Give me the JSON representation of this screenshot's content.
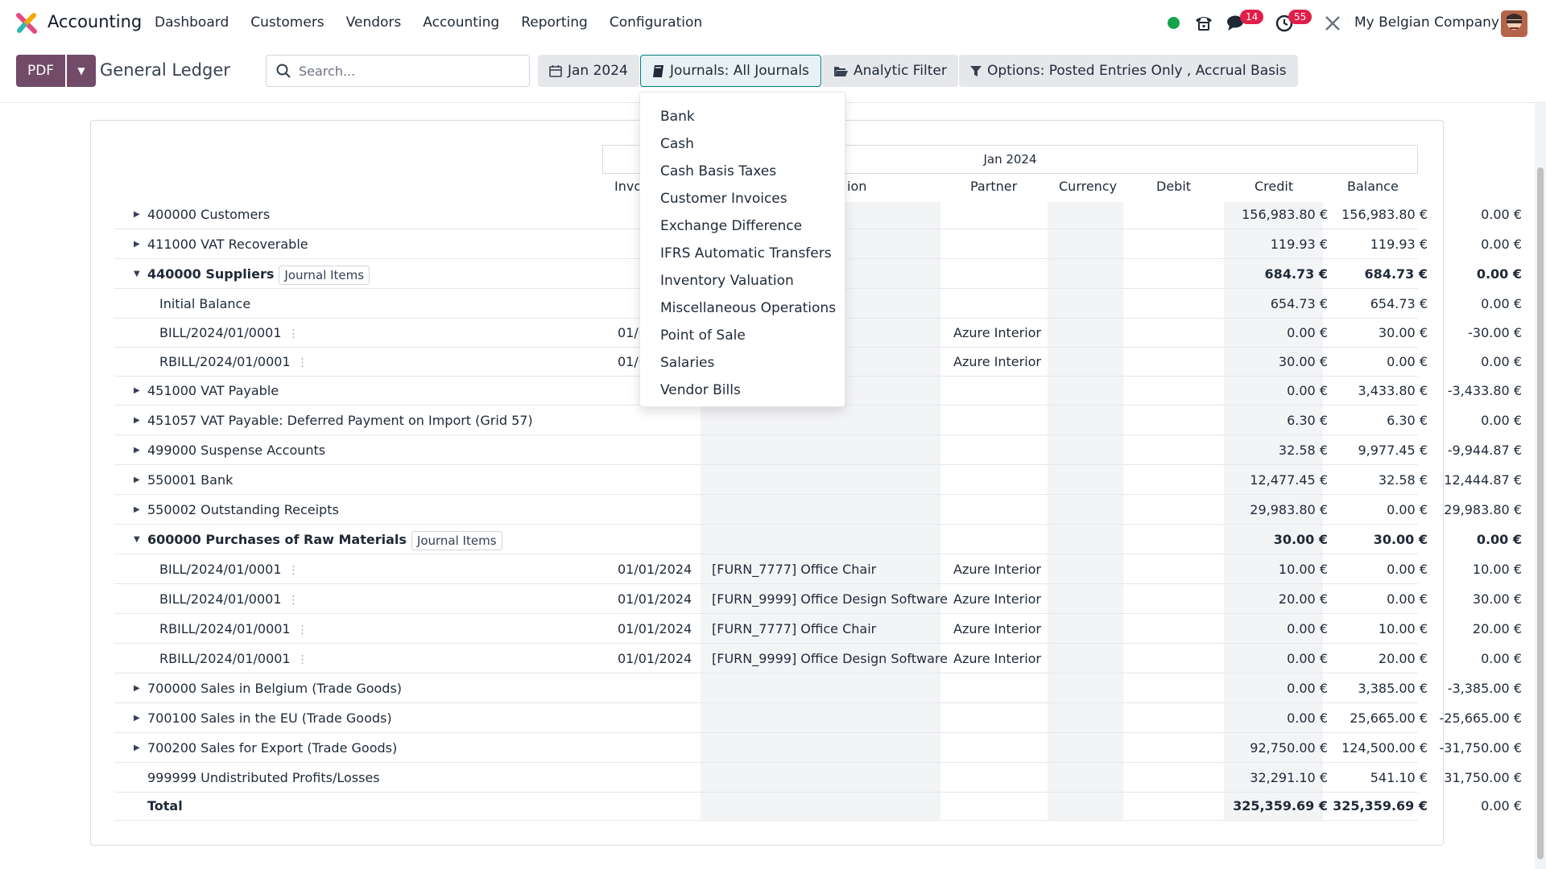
{
  "navbar": {
    "app_name": "Accounting",
    "menu": [
      "Dashboard",
      "Customers",
      "Vendors",
      "Accounting",
      "Reporting",
      "Configuration"
    ],
    "discuss_badge": "14",
    "activity_badge": "55",
    "company": "My Belgian Company"
  },
  "control_panel": {
    "pdf_label": "PDF",
    "title": "General Ledger",
    "search_placeholder": "Search...",
    "date_filter": "Jan 2024",
    "journals_filter": "Journals: All Journals",
    "analytic_filter": "Analytic Filter",
    "options_filter": "Options: Posted Entries Only , Accrual Basis"
  },
  "journals_dropdown": [
    "Bank",
    "Cash",
    "Cash Basis Taxes",
    "Customer Invoices",
    "Exchange Difference",
    "IFRS Automatic Transfers",
    "Inventory Valuation",
    "Miscellaneous Operations",
    "Point of Sale",
    "Salaries",
    "Vendor Bills"
  ],
  "report": {
    "period": "Jan 2024",
    "columns": {
      "invoice_date": "Invo",
      "communication": "ion",
      "partner": "Partner",
      "currency": "Currency",
      "debit": "Debit",
      "credit": "Credit",
      "balance": "Balance"
    },
    "journal_items_tag": "Journal Items",
    "rows": [
      {
        "name": "400000 Customers",
        "debit": "156,983.80 €",
        "credit": "156,983.80 €",
        "balance": "0.00 €"
      },
      {
        "name": "411000 VAT Recoverable",
        "debit": "119.93 €",
        "credit": "119.93 €",
        "balance": "0.00 €"
      },
      {
        "name": "440000 Suppliers",
        "debit": "684.73 €",
        "credit": "684.73 €",
        "balance": "0.00 €"
      },
      {
        "name": "Initial Balance",
        "debit": "654.73 €",
        "credit": "654.73 €",
        "balance": "0.00 €"
      },
      {
        "name": "BILL/2024/01/0001",
        "date": "01/0",
        "partner": "Azure Interior",
        "debit": "0.00 €",
        "credit": "30.00 €",
        "balance": "-30.00 €"
      },
      {
        "name": "RBILL/2024/01/0001",
        "date": "01/0",
        "partner": "Azure Interior",
        "debit": "30.00 €",
        "credit": "0.00 €",
        "balance": "0.00 €"
      },
      {
        "name": "451000 VAT Payable",
        "debit": "0.00 €",
        "credit": "3,433.80 €",
        "balance": "-3,433.80 €"
      },
      {
        "name": "451057 VAT Payable: Deferred Payment on Import (Grid 57)",
        "debit": "6.30 €",
        "credit": "6.30 €",
        "balance": "0.00 €"
      },
      {
        "name": "499000 Suspense Accounts",
        "debit": "32.58 €",
        "credit": "9,977.45 €",
        "balance": "-9,944.87 €"
      },
      {
        "name": "550001 Bank",
        "debit": "12,477.45 €",
        "credit": "32.58 €",
        "balance": "12,444.87 €"
      },
      {
        "name": "550002 Outstanding Receipts",
        "debit": "29,983.80 €",
        "credit": "0.00 €",
        "balance": "29,983.80 €"
      },
      {
        "name": "600000 Purchases of Raw Materials",
        "debit": "30.00 €",
        "credit": "30.00 €",
        "balance": "0.00 €"
      },
      {
        "name": "BILL/2024/01/0001",
        "date": "01/01/2024",
        "communication": "[FURN_7777] Office Chair",
        "partner": "Azure Interior",
        "debit": "10.00 €",
        "credit": "0.00 €",
        "balance": "10.00 €"
      },
      {
        "name": "BILL/2024/01/0001",
        "date": "01/01/2024",
        "communication": "[FURN_9999] Office Design Software",
        "partner": "Azure Interior",
        "debit": "20.00 €",
        "credit": "0.00 €",
        "balance": "30.00 €"
      },
      {
        "name": "RBILL/2024/01/0001",
        "date": "01/01/2024",
        "communication": "[FURN_7777] Office Chair",
        "partner": "Azure Interior",
        "debit": "0.00 €",
        "credit": "10.00 €",
        "balance": "20.00 €"
      },
      {
        "name": "RBILL/2024/01/0001",
        "date": "01/01/2024",
        "communication": "[FURN_9999] Office Design Software",
        "partner": "Azure Interior",
        "debit": "0.00 €",
        "credit": "20.00 €",
        "balance": "0.00 €"
      },
      {
        "name": "700000 Sales in Belgium (Trade Goods)",
        "debit": "0.00 €",
        "credit": "3,385.00 €",
        "balance": "-3,385.00 €"
      },
      {
        "name": "700100 Sales in the EU (Trade Goods)",
        "debit": "0.00 €",
        "credit": "25,665.00 €",
        "balance": "-25,665.00 €"
      },
      {
        "name": "700200 Sales for Export (Trade Goods)",
        "debit": "92,750.00 €",
        "credit": "124,500.00 €",
        "balance": "-31,750.00 €"
      },
      {
        "name": "999999 Undistributed Profits/Losses",
        "debit": "32,291.10 €",
        "credit": "541.10 €",
        "balance": "31,750.00 €"
      },
      {
        "name": "Total",
        "debit": "325,359.69 €",
        "credit": "325,359.69 €",
        "balance": "0.00 €"
      }
    ]
  }
}
